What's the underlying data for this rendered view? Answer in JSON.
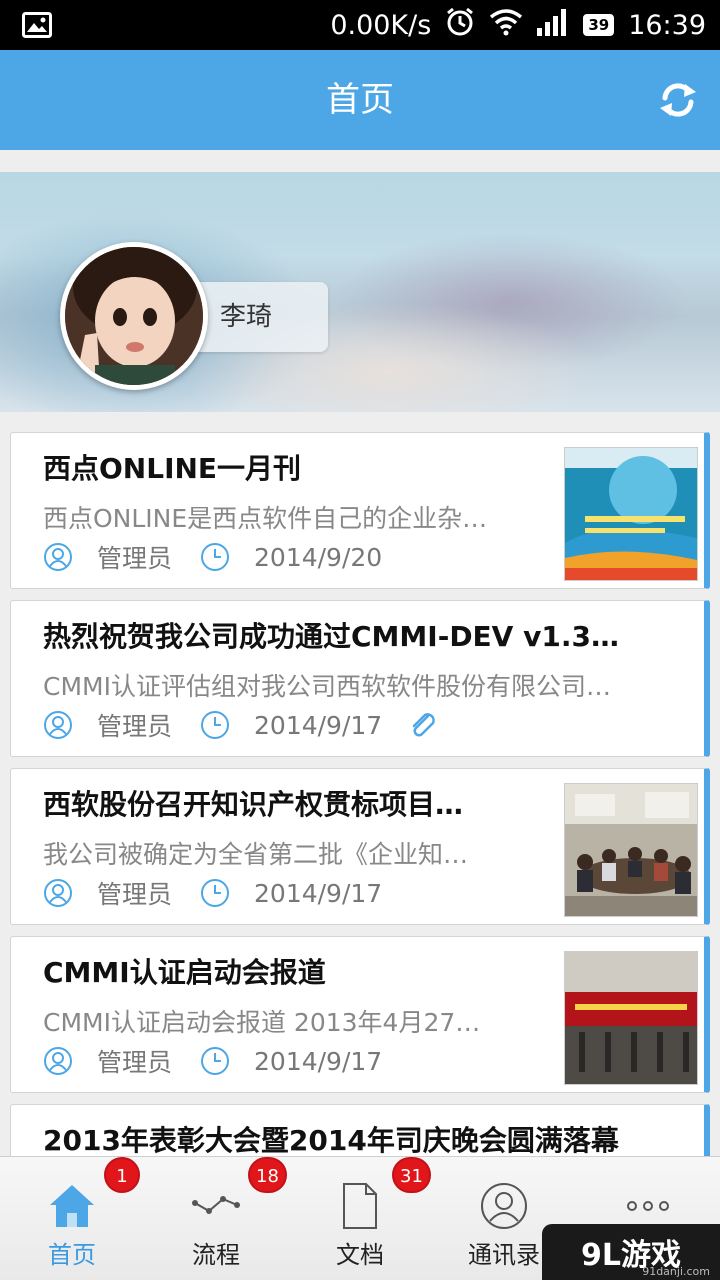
{
  "status_bar": {
    "speed": "0.00K/s",
    "battery": "39",
    "time": "16:39",
    "icons": [
      "gallery-icon",
      "alarm-icon",
      "wifi-icon",
      "signal-icon",
      "battery-icon"
    ]
  },
  "app_bar": {
    "title": "首页",
    "action_icon": "refresh-icon"
  },
  "profile": {
    "name": "李琦"
  },
  "news": [
    {
      "title": "西点ONLINE一月刊",
      "summary": "西点ONLINE是西点软件自己的企业杂…",
      "author": "管理员",
      "date": "2014/9/20",
      "has_thumb": true,
      "has_attachment": false
    },
    {
      "title": "热烈祝贺我公司成功通过CMMI-DEV v1.3…",
      "summary": "CMMI认证评估组对我公司西软软件股份有限公司…",
      "author": "管理员",
      "date": "2014/9/17",
      "has_thumb": false,
      "has_attachment": true
    },
    {
      "title": "西软股份召开知识产权贯标项目…",
      "summary": "我公司被确定为全省第二批《企业知…",
      "author": "管理员",
      "date": "2014/9/17",
      "has_thumb": true,
      "has_attachment": false
    },
    {
      "title": "CMMI认证启动会报道",
      "summary": "CMMI认证启动会报道 2013年4月27…",
      "author": "管理员",
      "date": "2014/9/17",
      "has_thumb": true,
      "has_attachment": false
    },
    {
      "title": "2013年表彰大会暨2014年司庆晚会圆满落幕",
      "summary": "",
      "author": "",
      "date": "",
      "has_thumb": false,
      "has_attachment": false
    }
  ],
  "tabs": [
    {
      "label": "首页",
      "icon": "home-icon",
      "badge": "1",
      "active": true
    },
    {
      "label": "流程",
      "icon": "flow-icon",
      "badge": "18",
      "active": false
    },
    {
      "label": "文档",
      "icon": "document-icon",
      "badge": "31",
      "active": false
    },
    {
      "label": "通讯录",
      "icon": "contacts-icon",
      "badge": "",
      "active": false
    },
    {
      "label": "",
      "icon": "more-icon",
      "badge": "",
      "active": false
    }
  ],
  "watermark": {
    "text": "9L游戏",
    "sub": "91danji.com"
  },
  "colors": {
    "accent": "#4da7e6",
    "badge": "#e0161b",
    "tab_active": "#3a9ae0"
  }
}
